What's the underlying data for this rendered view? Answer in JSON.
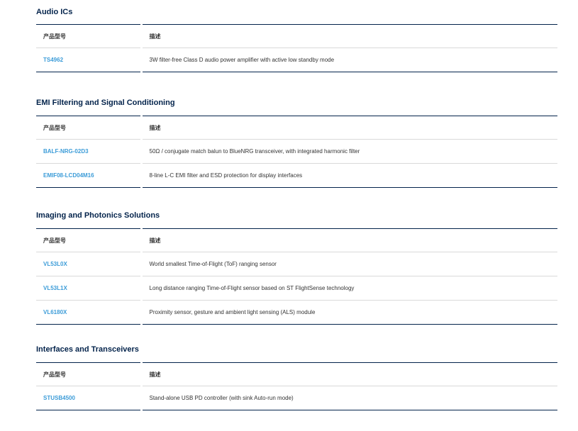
{
  "sections": [
    {
      "title": "Audio ICs",
      "header": {
        "part": "产品型号",
        "desc": "描述"
      },
      "rows": [
        {
          "part": "TS4962",
          "desc": "3W filter-free Class D audio power amplifier with active low standby mode"
        }
      ]
    },
    {
      "title": "EMI Filtering and Signal Conditioning",
      "header": {
        "part": "产品型号",
        "desc": "描述"
      },
      "rows": [
        {
          "part": "BALF-NRG-02D3",
          "desc": "50Ω / conjugate match balun to BlueNRG transceiver, with integrated harmonic filter"
        },
        {
          "part": "EMIF08-LCD04M16",
          "desc": "8-line L-C EMI filter and ESD protection for display interfaces"
        }
      ]
    },
    {
      "title": "Imaging and Photonics Solutions",
      "header": {
        "part": "产品型号",
        "desc": "描述"
      },
      "rows": [
        {
          "part": "VL53L0X",
          "desc": "World smallest Time-of-Flight (ToF) ranging sensor"
        },
        {
          "part": "VL53L1X",
          "desc": "Long distance ranging Time-of-Flight sensor based on ST FlightSense technology"
        },
        {
          "part": "VL6180X",
          "desc": "Proximity sensor, gesture and ambient light sensing (ALS) module"
        }
      ]
    },
    {
      "title": "Interfaces and Transceivers",
      "header": {
        "part": "产品型号",
        "desc": "描述"
      },
      "rows": [
        {
          "part": "STUSB4500",
          "desc": "Stand-alone USB PD controller (with sink Auto-run mode)"
        }
      ]
    }
  ],
  "colors": {
    "heading": "#03234b",
    "link": "#3c9cd8",
    "text": "#333333",
    "rule": "#03234b",
    "row_divider": "#d9d9d9"
  }
}
